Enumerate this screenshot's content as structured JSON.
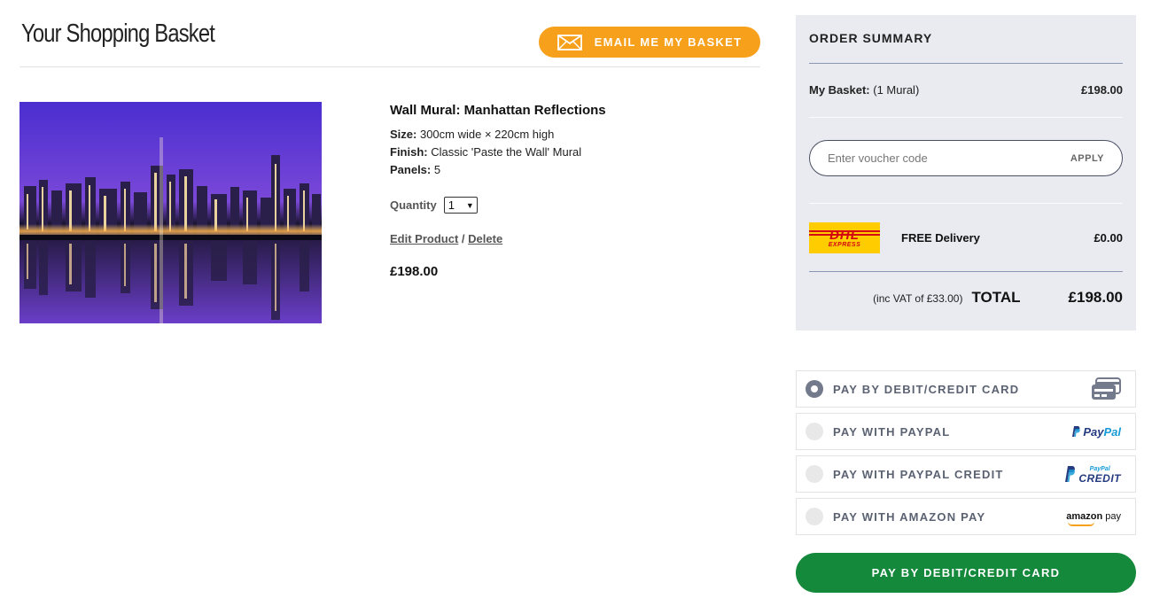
{
  "page": {
    "title": "Your Shopping Basket",
    "email_button_label": "EMAIL ME MY BASKET"
  },
  "product": {
    "image_alt": "Manhattan skyline at night reflected in water, purple sky",
    "name": "Wall Mural: Manhattan Reflections",
    "specs": [
      {
        "label": "Size:",
        "value": "300cm wide × 220cm high"
      },
      {
        "label": "Finish:",
        "value": "Classic 'Paste the Wall' Mural"
      },
      {
        "label": "Panels:",
        "value": "5"
      }
    ],
    "quantity_label": "Quantity",
    "quantity_value": "1",
    "edit_link": "Edit Product",
    "separator": "/",
    "delete_link": "Delete",
    "price": "£198.00"
  },
  "summary": {
    "title": "ORDER SUMMARY",
    "basket_label": "My Basket:",
    "basket_count": "(1 Mural)",
    "basket_price": "£198.00",
    "voucher_placeholder": "Enter voucher code",
    "apply_label": "APPLY",
    "courier_logo_text": "DHL",
    "courier_logo_subtext": "EXPRESS",
    "delivery_label": "FREE Delivery",
    "delivery_price": "£0.00",
    "vat_text": "(inc VAT of £33.00)",
    "total_label": "TOTAL",
    "total_price": "£198.00"
  },
  "payment": {
    "options": [
      {
        "label": "PAY BY DEBIT/CREDIT CARD",
        "selected": true,
        "icon": "card-icon"
      },
      {
        "label": "PAY WITH PAYPAL",
        "selected": false,
        "icon": "paypal-logo",
        "logo_part1": "Pay",
        "logo_part2": "Pal"
      },
      {
        "label": "PAY WITH PAYPAL CREDIT",
        "selected": false,
        "icon": "paypal-credit-logo",
        "logo_small": "PayPal",
        "logo_big": "CREDIT"
      },
      {
        "label": "PAY WITH AMAZON PAY",
        "selected": false,
        "icon": "amazon-pay-logo",
        "logo_part1": "amazon",
        "logo_part2": "pay"
      }
    ],
    "pay_button_label": "PAY BY DEBIT/CREDIT CARD"
  },
  "colors": {
    "accent_orange": "#f7a01c",
    "pay_green": "#14893b",
    "summary_bg": "#e9ebf1"
  }
}
